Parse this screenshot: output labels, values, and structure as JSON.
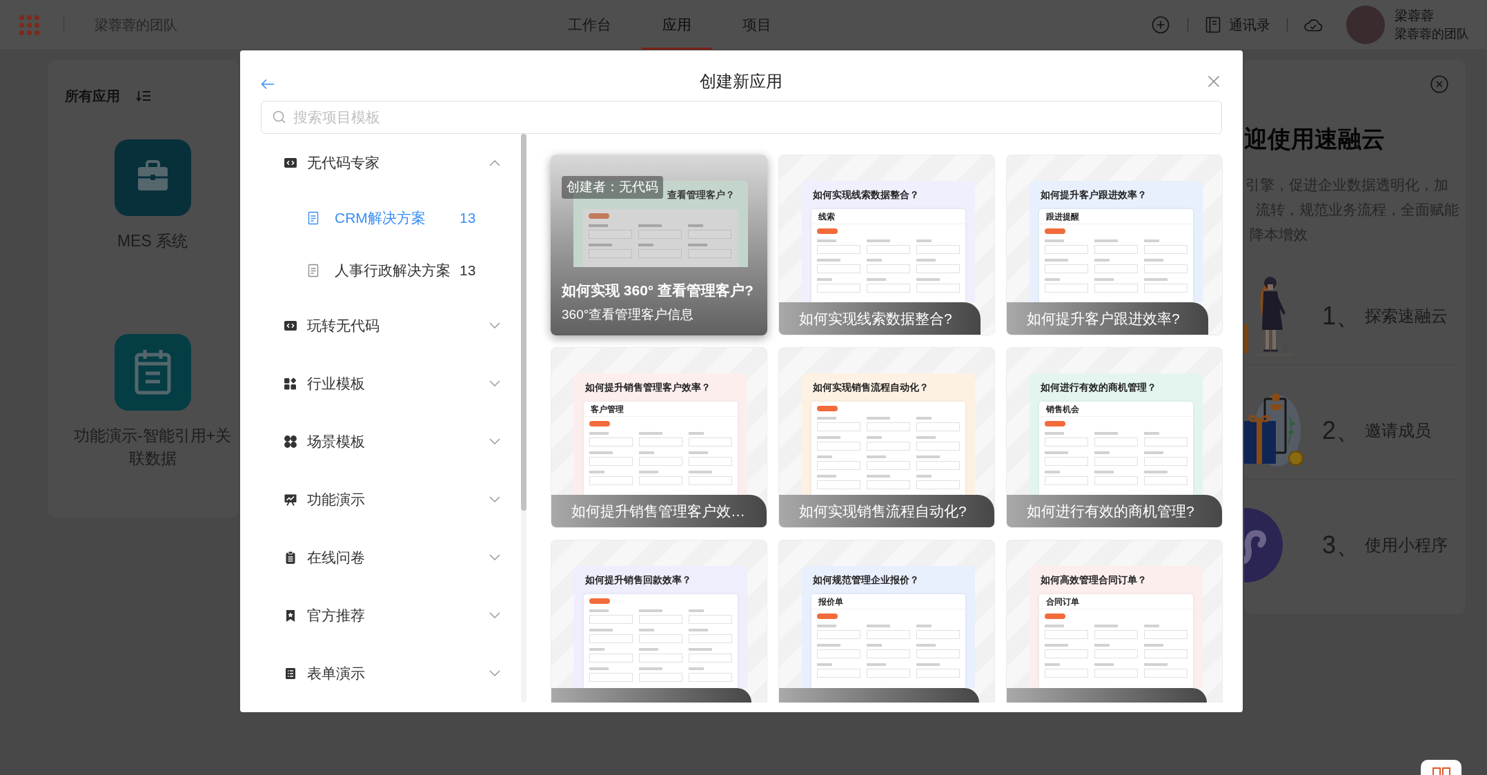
{
  "top_bar": {
    "team_name": "梁蓉蓉的团队",
    "tabs": [
      {
        "label": "工作台",
        "selected": false
      },
      {
        "label": "应用",
        "selected": true
      },
      {
        "label": "项目",
        "selected": false
      }
    ],
    "contacts": "通讯录",
    "user": {
      "name": "梁蓉蓉",
      "team": "梁蓉蓉的团队"
    }
  },
  "apps_panel": {
    "title": "所有应用",
    "apps": [
      {
        "name": "MES 系统"
      },
      {
        "name": "功能演示-智能引用+关联数据"
      }
    ]
  },
  "welcome_panel": {
    "title": "迎使用速融云",
    "description_lines": [
      "引擎，促进企业数据透明化，加",
      "流转，规范业务流程，全面赋能",
      "降本增效"
    ],
    "steps": [
      {
        "number": "1、",
        "label": "探索速融云"
      },
      {
        "number": "2、",
        "label": "邀请成员"
      },
      {
        "number": "3、",
        "label": "使用小程序"
      }
    ]
  },
  "modal": {
    "title": "创建新应用",
    "search": {
      "placeholder": "搜索项目模板"
    },
    "sidebar": {
      "items": [
        {
          "label": "无代码专家",
          "expanded": true,
          "children": [
            {
              "label": "CRM解决方案",
              "count": "13",
              "selected": true
            },
            {
              "label": "人事行政解决方案",
              "count": "13",
              "selected": false
            }
          ]
        },
        {
          "label": "玩转无代码",
          "expanded": false
        },
        {
          "label": "行业模板",
          "expanded": false
        },
        {
          "label": "场景模板",
          "expanded": false
        },
        {
          "label": "功能演示",
          "expanded": false
        },
        {
          "label": "在线问卷",
          "expanded": false
        },
        {
          "label": "官方推荐",
          "expanded": false
        },
        {
          "label": "表单演示",
          "expanded": false
        }
      ]
    },
    "cards": [
      {
        "hovered": true,
        "badge": "创建者：无代码",
        "preview_heading": "查看管理客户？",
        "title": "如何实现 360° 查看管理客户?",
        "description": "360°查看管理客户信息",
        "color": "#c4d6cc"
      },
      {
        "hovered": false,
        "preview_heading": "如何实现线索数据整合？",
        "panel_title": "线索",
        "title": "如何实现线索数据整合?",
        "color": "#efeffd"
      },
      {
        "hovered": false,
        "preview_heading": "如何提升客户跟进效率？",
        "panel_title": "跟进提醒",
        "title": "如何提升客户跟进效率?",
        "color": "#e8f0fd"
      },
      {
        "hovered": false,
        "preview_heading": "如何提升销售管理客户效率？",
        "panel_title": "客户管理",
        "title": "如何提升销售管理客户效…",
        "color": "#fdeeee"
      },
      {
        "hovered": false,
        "preview_heading": "如何实现销售流程自动化？",
        "title": "如何实现销售流程自动化?",
        "color": "#fdf1e3"
      },
      {
        "hovered": false,
        "preview_heading": "如何进行有效的商机管理？",
        "panel_title": "销售机会",
        "title": "如何进行有效的商机管理?",
        "color": "#e3f5ee"
      },
      {
        "hovered": false,
        "preview_heading": "如何提升销售回款效率？",
        "color": "#eeeefc"
      },
      {
        "hovered": false,
        "preview_heading": "如何规范管理企业报价？",
        "panel_title": "报价单",
        "color": "#e8effd"
      },
      {
        "hovered": false,
        "preview_heading": "如何高效管理合同订单？",
        "panel_title": "合同订单",
        "color": "#fdeeee"
      }
    ]
  }
}
